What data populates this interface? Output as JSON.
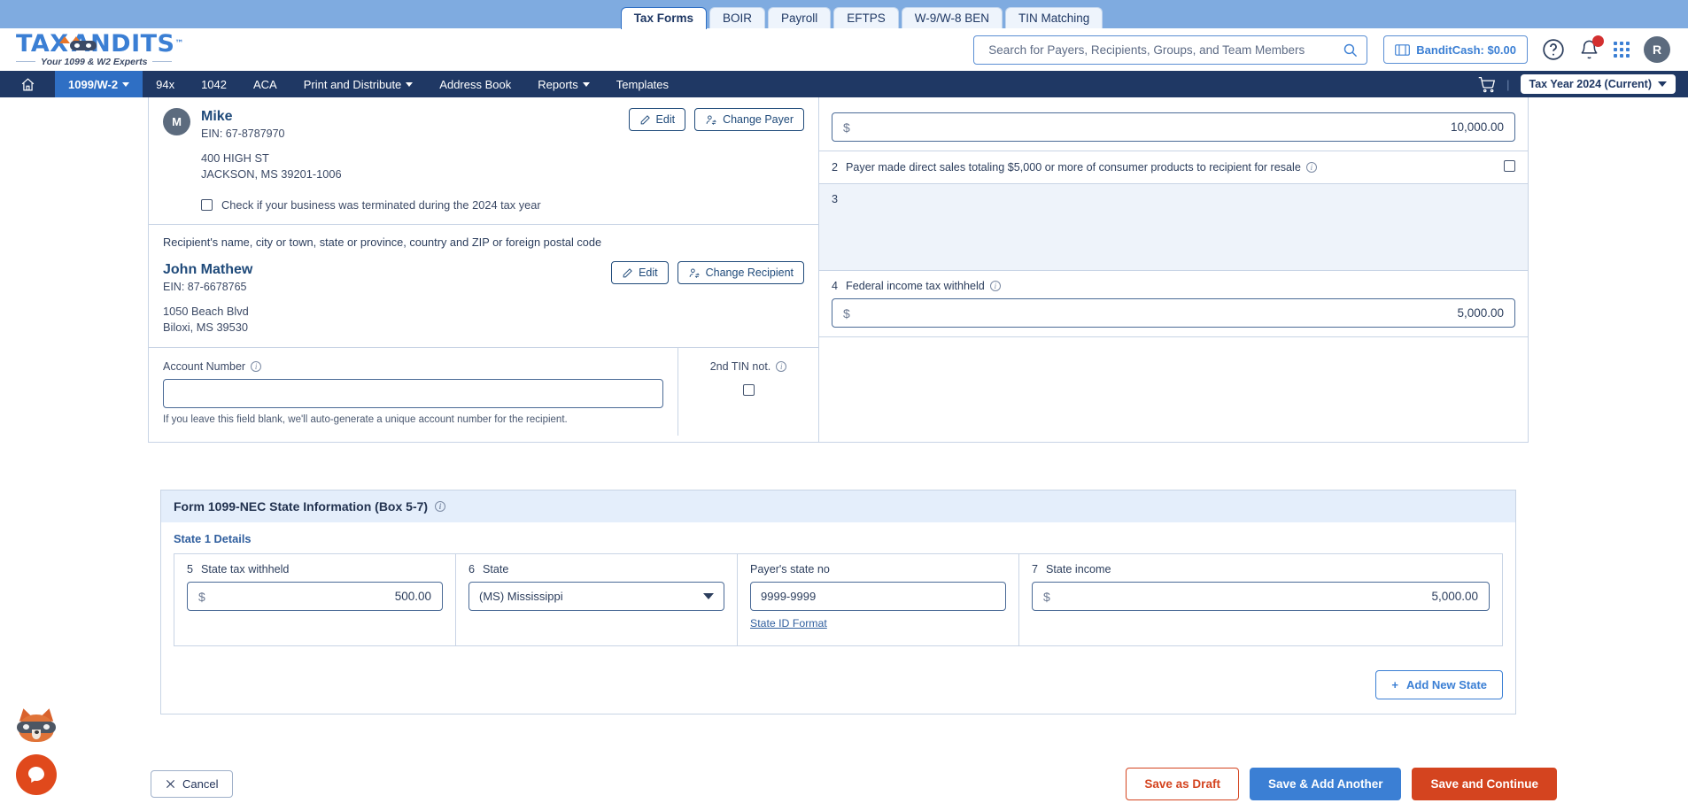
{
  "browser_tabs": [
    {
      "label": "Tax Forms",
      "active": true
    },
    {
      "label": "BOIR",
      "active": false
    },
    {
      "label": "Payroll",
      "active": false
    },
    {
      "label": "EFTPS",
      "active": false
    },
    {
      "label": "W-9/W-8 BEN",
      "active": false
    },
    {
      "label": "TIN Matching",
      "active": false
    }
  ],
  "header": {
    "logo_part1": "TAX",
    "logo_part2": "ANDITS",
    "logo_tm": "™",
    "logo_tagline": "Your 1099 & W2 Experts",
    "search_placeholder": "Search for Payers, Recipients, Groups, and Team Members",
    "search_value": "",
    "bandit_cash_label": "BanditCash: $0.00",
    "avatar_initial": "R",
    "accent_blue": "#3b7fd4",
    "notification_dot_color": "#d32f2f"
  },
  "nav": {
    "items": [
      {
        "label": "1099/W-2",
        "caret": true,
        "active": true
      },
      {
        "label": "94x",
        "caret": false,
        "active": false
      },
      {
        "label": "1042",
        "caret": false,
        "active": false
      },
      {
        "label": "ACA",
        "caret": false,
        "active": false
      },
      {
        "label": "Print and Distribute",
        "caret": true,
        "active": false
      },
      {
        "label": "Address Book",
        "caret": false,
        "active": false
      },
      {
        "label": "Reports",
        "caret": true,
        "active": false
      },
      {
        "label": "Templates",
        "caret": false,
        "active": false
      }
    ],
    "separator": "|",
    "tax_year": "Tax Year 2024 (Current)",
    "bar_color": "#1f3864",
    "active_color": "#2f6fc4"
  },
  "payer": {
    "avatar_initial": "M",
    "name": "Mike",
    "ein": "EIN: 67-8787970",
    "address_line1": "400 HIGH ST",
    "address_line2": "JACKSON, MS 39201-1006",
    "edit_label": "Edit",
    "change_label": "Change Payer",
    "terminated_checkbox_label": "Check if your business was terminated during the 2024 tax year",
    "terminated_checked": false
  },
  "recipient": {
    "section_label": "Recipient's name, city or town, state or province, country and ZIP or foreign postal code",
    "name": "John Mathew",
    "ein": "EIN: 87-6678765",
    "address_line1": "1050 Beach Blvd",
    "address_line2": "Biloxi, MS 39530",
    "edit_label": "Edit",
    "change_label": "Change Recipient"
  },
  "account": {
    "label": "Account Number",
    "value": "",
    "hint": "If you leave this field blank, we'll auto-generate a unique account number for the recipient.",
    "second_tin_label": "2nd TIN not.",
    "second_tin_checked": false
  },
  "boxes": {
    "box1": {
      "dollar": "$",
      "value": "10,000.00"
    },
    "box2": {
      "num": "2",
      "label": "Payer made direct sales totaling $5,000 or more of consumer products to recipient for resale",
      "checked": false
    },
    "box3": {
      "num": "3",
      "label": ""
    },
    "box4": {
      "num": "4",
      "label": "Federal income tax withheld",
      "dollar": "$",
      "value": "5,000.00"
    }
  },
  "state_section": {
    "title": "Form 1099-NEC  State Information  (Box 5-7)",
    "state_details_label": "State 1 Details",
    "fields": {
      "state_tax_withheld": {
        "num": "5",
        "label": "State tax withheld",
        "dollar": "$",
        "value": "500.00"
      },
      "state": {
        "num": "6",
        "label": "State",
        "value": "(MS) Mississippi"
      },
      "payers_state_no": {
        "label": "Payer's state no",
        "value": "9999-9999",
        "link": "State ID Format"
      },
      "state_income": {
        "num": "7",
        "label": "State income",
        "dollar": "$",
        "value": "5,000.00"
      }
    },
    "add_new_state_label": "Add New State",
    "add_new_state_plus": "+",
    "header_bg": "#e4eefb"
  },
  "footer": {
    "cancel_label": "Cancel",
    "save_draft_label": "Save as Draft",
    "save_add_another_label": "Save & Add Another",
    "save_continue_label": "Save and Continue",
    "primary_red": "#d4441f",
    "primary_blue": "#3b7fd4"
  },
  "chat": {
    "mascot_name": "raccoon-mascot",
    "button_color": "#e0491c"
  }
}
